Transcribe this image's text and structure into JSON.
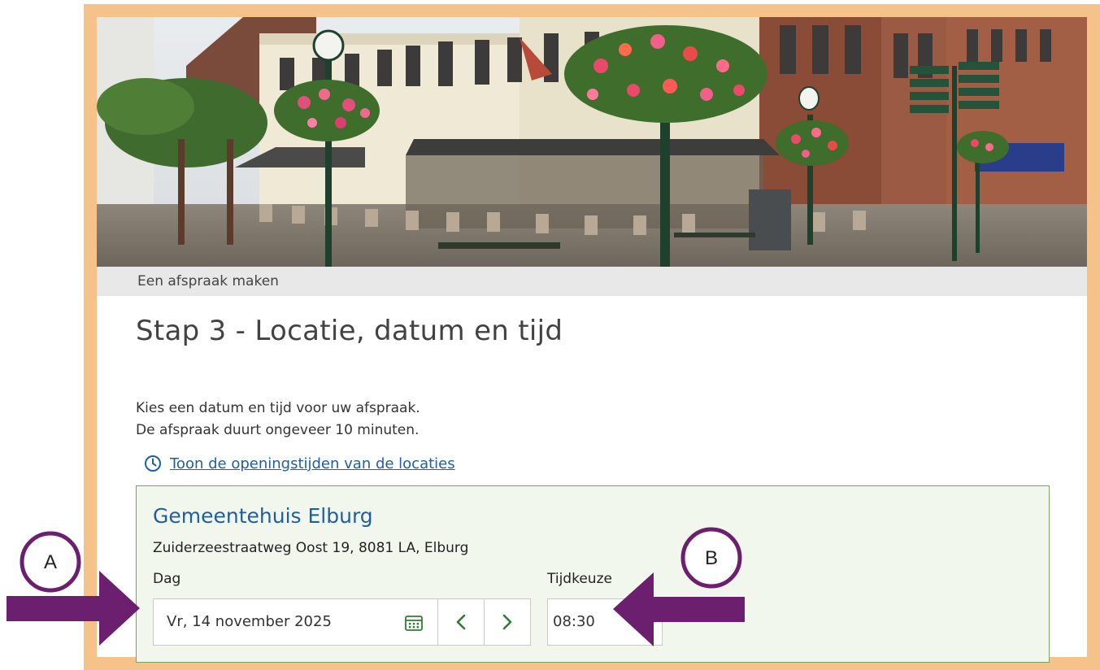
{
  "breadcrumb": "Een afspraak maken",
  "page_title": "Stap 3 - Locatie, datum en tijd",
  "intro_lines": [
    "Kies een datum en tijd voor uw afspraak.",
    "De afspraak duurt ongeveer 10 minuten."
  ],
  "opening_hours_link": "Toon de openingstijden van de locaties",
  "location": {
    "name": "Gemeentehuis Elburg",
    "address": "Zuiderzeestraatweg Oost 19, 8081 LA, Elburg"
  },
  "day_label": "Dag",
  "day_value": "Vr, 14 november 2025",
  "time_label": "Tijdkeuze",
  "time_value": "08:30",
  "annotations": {
    "a": "A",
    "b": "B"
  },
  "colors": {
    "frame": "#f5c289",
    "arrow": "#6b1f6e",
    "link": "#1f5fa0",
    "nav_chevron": "#2e7d32",
    "card_border": "#7fa060"
  }
}
